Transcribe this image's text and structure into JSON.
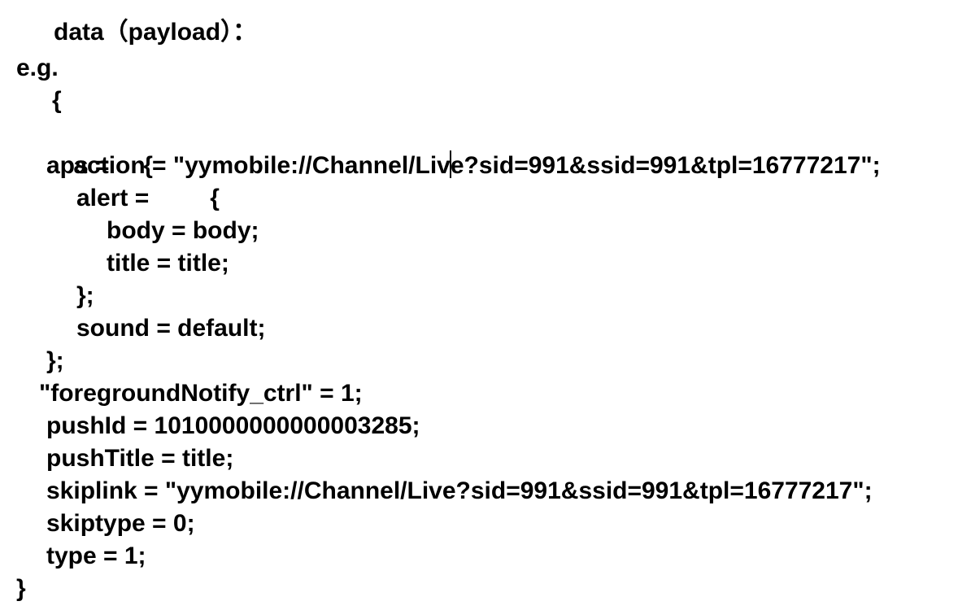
{
  "document": {
    "heading": "data（payload）：",
    "example_label": "e.g.",
    "open_brace": "{",
    "action_before_cursor": "action = \"yymobile://Channel/Liv",
    "action_after_cursor": "e?sid=991&ssid=991&tpl=16777217\";",
    "aps_open": "aps =     {",
    "alert_open": "alert =         {",
    "body_line": "body = body;",
    "title_line": "title = title;",
    "alert_close": "};",
    "sound_line": "sound = default;",
    "aps_close": "};",
    "foreground_line": "\"foregroundNotify_ctrl\" = 1;",
    "pushid_line": "pushId = 1010000000000003285;",
    "pushtitle_line": "pushTitle = title;",
    "skiplink_line": "skiplink = \"yymobile://Channel/Live?sid=991&ssid=991&tpl=16777217\";",
    "skiptype_line": "skiptype = 0;",
    "type_line": "type = 1;",
    "close_brace": "}"
  }
}
